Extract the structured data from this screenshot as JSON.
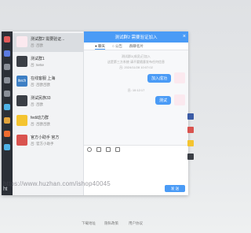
{
  "nav": {
    "icons": [
      {
        "name": "chat-icon",
        "color": "#e25b5b"
      },
      {
        "name": "contacts-icon",
        "color": "#5b7be2"
      },
      {
        "name": "group-icon",
        "color": "#8a8f98"
      },
      {
        "name": "list-icon",
        "color": "#8a8f98"
      },
      {
        "name": "calendar-icon",
        "color": "#8a8f98"
      },
      {
        "name": "user-icon",
        "color": "#4fb3e8"
      },
      {
        "name": "settings-icon",
        "color": "#e2a33b"
      },
      {
        "name": "rss-icon",
        "color": "#ef6c2f"
      },
      {
        "name": "apps-icon",
        "color": "#4fb3e8"
      }
    ],
    "footer": "ht"
  },
  "contacts": [
    {
      "name": "测试群2 需要验证...",
      "msg": "吕: 吕欧",
      "avatar": "",
      "color": "#fbe9ef",
      "active": true
    },
    {
      "name": "测试群1",
      "msg": "吕: 5e5e",
      "avatar": "",
      "color": "#3b3f46",
      "active": false
    },
    {
      "name": "在线客服 上海",
      "msg": "吕: 吕欧吕欧",
      "avatar": "itech",
      "color": "#3d7fc4",
      "active": false
    },
    {
      "name": "测试民族33",
      "msg": "吕: 吕欧",
      "avatar": "",
      "color": "#3b3f46",
      "active": false
    },
    {
      "name": "fedi动力群",
      "msg": "吕: 吕欧吕欧",
      "avatar": "",
      "color": "#f4c430",
      "active": false
    },
    {
      "name": "官方小助手 官方",
      "msg": "吕: 官方小助手",
      "avatar": "",
      "color": "#d9534f",
      "active": false
    }
  ],
  "chat": {
    "title": "测试群2 需要验证加入",
    "close_icon": "×",
    "tabs": [
      {
        "label": "● 聊天",
        "active": true
      },
      {
        "label": "○ 公告",
        "active": false
      },
      {
        "label": "群聊名片",
        "active": false
      }
    ],
    "system_lines": [
      "测试群2(成员)已加入",
      "这是第三方系统 请不要随意发布任何信息",
      "吕: 2024/11/28 10:07:02"
    ],
    "messages": [
      {
        "text": "加入成功"
      },
      {
        "text": "测试"
      }
    ],
    "timestamps": [
      "吕: 10:07:09",
      "吕: 10:12:17"
    ],
    "toolbar": [
      "emoji-icon",
      "image-icon",
      "file-icon",
      "folder-icon"
    ],
    "send_label": "发 送"
  },
  "side_thumbs": [
    {
      "color": "#3b5ba5"
    },
    {
      "color": "#d9534f"
    },
    {
      "color": "#f4c430"
    },
    {
      "color": "#3b3f46"
    }
  ],
  "watermark": "https://www.huzhan.com/ishop40045",
  "footer_links": [
    "下载地址",
    "隐私政策",
    "用户协议"
  ]
}
